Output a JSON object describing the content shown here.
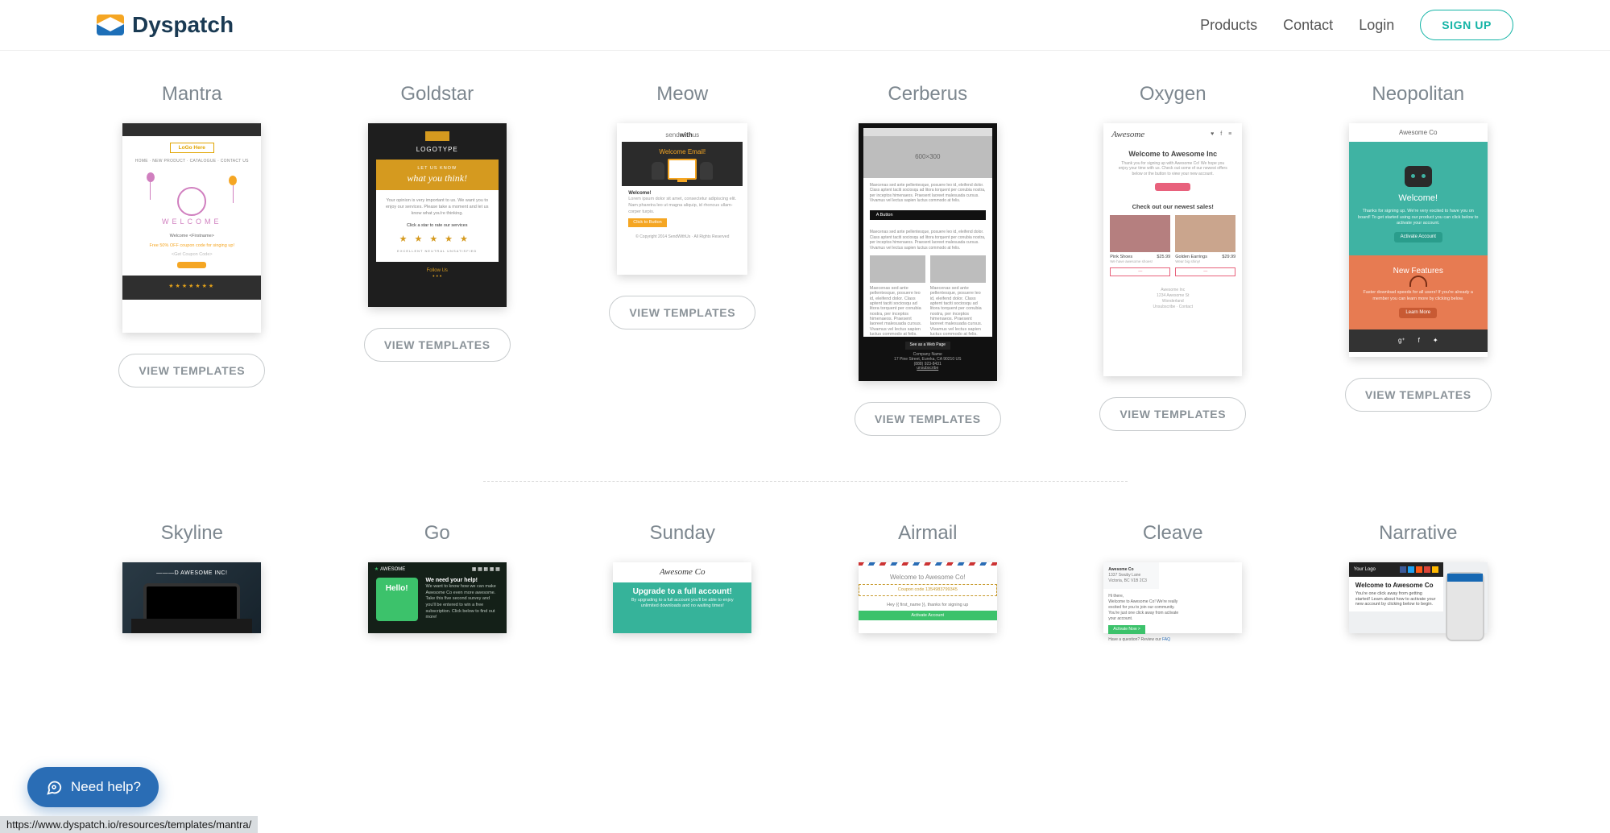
{
  "brand": "Dyspatch",
  "nav": {
    "products": "Products",
    "contact": "Contact",
    "login": "Login",
    "signup": "SIGN UP"
  },
  "view_templates": "VIEW TEMPLATES",
  "row1": [
    {
      "title": "Mantra"
    },
    {
      "title": "Goldstar"
    },
    {
      "title": "Meow"
    },
    {
      "title": "Cerberus"
    },
    {
      "title": "Oxygen"
    },
    {
      "title": "Neopolitan"
    }
  ],
  "row2": [
    {
      "title": "Skyline"
    },
    {
      "title": "Go"
    },
    {
      "title": "Sunday"
    },
    {
      "title": "Airmail"
    },
    {
      "title": "Cleave"
    },
    {
      "title": "Narrative"
    }
  ],
  "thumbs": {
    "mantra": {
      "logo": "LoGo Here",
      "menu": "HOME · NEW PRODUCT · CATALOGUE · CONTACT US",
      "welcome": "WELCOME",
      "promo_title": "Welcome <Firstname>",
      "promo_line": "Free 50% OFF coupon code for singing up!",
      "coupon": "<Get Coupon Code>",
      "cta": "———",
      "stars": "★★★★★★★"
    },
    "goldstar": {
      "logotype": "LOGOTYPE",
      "let_us": "LET US KNOW",
      "think": "what you think!",
      "body1": "Your opinion is very important to us. We want you to enjoy our services. Please take a moment and let us know what you're thinking.",
      "rate": "Click a star to rate our services",
      "stars": "★★★★★",
      "labels": "EXCELLENT    NEUTRAL    UNSATISFIED",
      "follow": "Follow Us"
    },
    "meow": {
      "brand_a": "send",
      "brand_b": "with",
      "brand_c": "us",
      "headline": "Welcome Email!",
      "sub": "Welcome!",
      "para": "Lorem ipsum dolor sit amet, consectetur adipiscing elit. Nam pharetra leo ut magna aliquip, id rhoncus ullam-corper turpis.",
      "cta": "Click to Button",
      "foot": "© Copyright 2014 SendWithUs · All Rights Reserved"
    },
    "cerberus": {
      "img": "600×300",
      "para": "Maecenas sed ante pellentesque, posuere leo id, eleifend dolor. Class aptent taciti sociosqu ad litora torquent per conubia nostra, per inceptos himenaeos. Praesent laoreet malesuada cursus. Vivamus vel lectus sapien luctus commodo at felis.",
      "btn": "A Button",
      "foot_title": "See as a Web Page",
      "company": "Company Name",
      "addr": "17 Pine Street, Eureka, CA 90210 US\n(888) 923-8431",
      "unsub": "unsubscribe"
    },
    "oxygen": {
      "brand": "Awesome",
      "h": "Welcome to Awesome Inc",
      "sub": "Thank you for signing up with Awesome Co! We hope you enjoy your time with us. Check out some of our newest offers below or the button to view your new account.",
      "btn": "———",
      "sale": "Check out our newest sales!",
      "p1_name": "Pink Shoes",
      "p1_price": "$25.99",
      "p1_desc": "We have awesome shoes!",
      "p2_name": "Golden Earrings",
      "p2_price": "$29.99",
      "p2_desc": "Wear big shiny!",
      "addr": "Awesome Inc\n1234 Awesome St\nWonderland",
      "links": "Unsubscribe · Contact"
    },
    "neopolitan": {
      "brand": "Awesome Co",
      "welcome": "Welcome!",
      "wsub": "Thanks for signing up. We're very excited to have you on board! To get started using our product you can click below to activate your account.",
      "btn1": "Activate Account",
      "feat": "New Features",
      "fsub": "Faster download speeds for all users! If you're already a member you can learn more by clicking below.",
      "btn2": "Learn More"
    },
    "skyline": {
      "txt": "———D AWESOME INC!"
    },
    "go": {
      "brand": "AWESOME",
      "hello": "Hello!",
      "h": "We need your help!",
      "p": "We want to know how we can make Awesome Co even more awesome. Take this five second survey and you'll be entered to win a free subscription. Click below to find out more!"
    },
    "sunday": {
      "brand": "Awesome Co",
      "h": "Upgrade to a full account!",
      "p": "By upgrading to a full account you'll be able to enjoy unlimited downloads and no waiting times!"
    },
    "airmail": {
      "brand": "Welcome to Awesome Co!",
      "coupon": "Coupon code 1354983799345",
      "thx": "Hey {{ first_name }}, thanks for signing up",
      "btn": "Activate Account"
    },
    "cleave": {
      "co": "Awesome Co",
      "addr": "1337 Swuby Lane\nVictoria, BC V1B 2C3",
      "hi": "Hi there,",
      "p": "Welcome to Awesome Co! We're really excited for you to join our community. You're just one click away from activate your account.",
      "btn": "Activate Now >",
      "q": "Have a question? Review our ",
      "faq": "FAQ"
    },
    "narrative": {
      "logo": "Your Logo",
      "h": "Welcome to Awesome Co",
      "p": "You're one click away from getting started! Learn about how to activate your new account by clicking below to begin."
    }
  },
  "help": "Need help?",
  "status_url": "https://www.dyspatch.io/resources/templates/mantra/"
}
